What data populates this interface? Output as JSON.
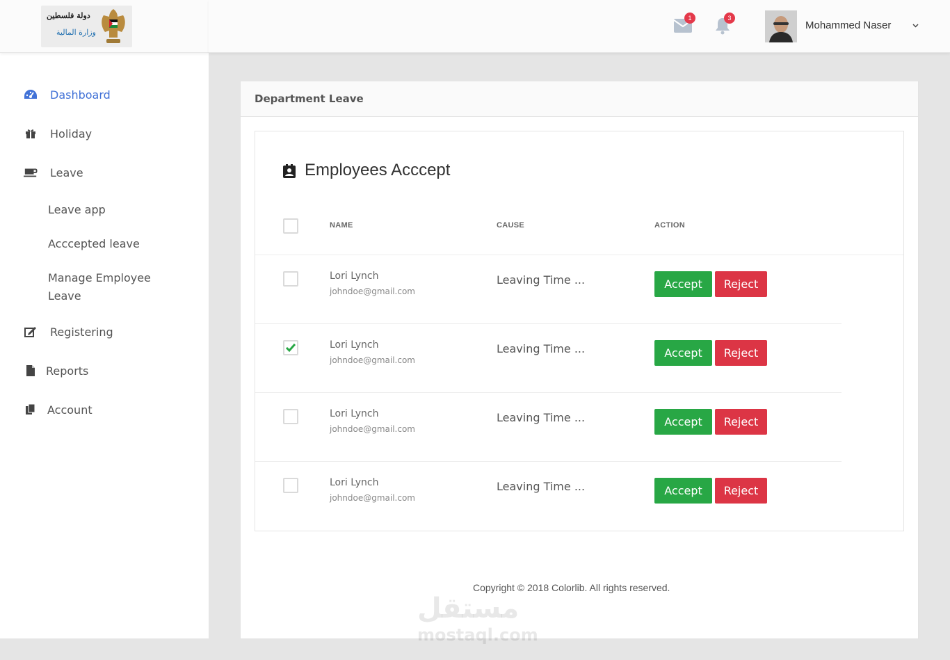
{
  "logo": {
    "arabic_line1": "دولة فلسطين",
    "arabic_line2": "وزارة المالية"
  },
  "sidebar": {
    "items": [
      {
        "label": "Dashboard",
        "icon": "tachometer-icon",
        "active": true
      },
      {
        "label": "Holiday",
        "icon": "gift-icon"
      },
      {
        "label": "Leave",
        "icon": "coffee-icon"
      },
      {
        "label": "Registering",
        "icon": "edit-icon"
      },
      {
        "label": "Reports",
        "icon": "file-icon"
      },
      {
        "label": "Account",
        "icon": "copy-icon"
      }
    ],
    "leave_subitems": [
      {
        "label": "Leave app"
      },
      {
        "label": "Acccepted leave"
      },
      {
        "label": "Manage Employee Leave"
      }
    ]
  },
  "header": {
    "mail_count": "1",
    "notification_count": "3",
    "user_name": "Mohammed Naser"
  },
  "card": {
    "title": "Department Leave",
    "section_title": "Employees Acccept",
    "columns": {
      "name": "NAME",
      "cause": "CAUSE",
      "action": "ACTION"
    },
    "rows": [
      {
        "name": "Lori Lynch",
        "email": "johndoe@gmail.com",
        "cause": "Leaving Time ...",
        "checked": false
      },
      {
        "name": "Lori Lynch",
        "email": "johndoe@gmail.com",
        "cause": "Leaving Time ...",
        "checked": true
      },
      {
        "name": "Lori Lynch",
        "email": "johndoe@gmail.com",
        "cause": "Leaving Time ...",
        "checked": false
      },
      {
        "name": "Lori Lynch",
        "email": "johndoe@gmail.com",
        "cause": "Leaving Time ...",
        "checked": false
      }
    ],
    "accept_label": "Accept",
    "reject_label": "Reject"
  },
  "footer": {
    "copyright": "Copyright © 2018 Colorlib. All rights reserved."
  },
  "watermark": {
    "arabic": "مستقل",
    "latin": "mostaql.com"
  },
  "colors": {
    "accent": "#4272d7",
    "accept": "#28a745",
    "reject": "#dc3545",
    "badge": "#e4394a",
    "check": "#28a745"
  }
}
